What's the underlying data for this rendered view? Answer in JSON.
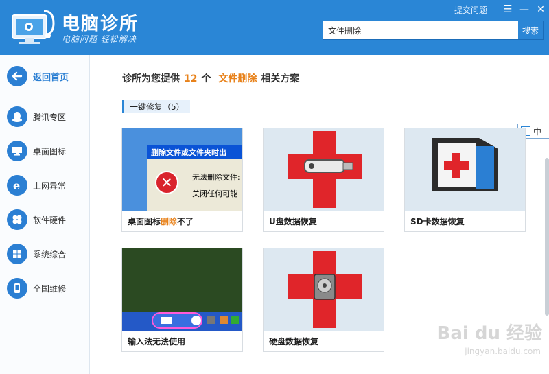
{
  "header": {
    "app_title": "电脑诊所",
    "slogan": "电脑问题 轻松解决",
    "submit_link": "提交问题",
    "menu_glyph": "☰",
    "min_glyph": "—",
    "close_glyph": "✕",
    "search_value": "文件删除",
    "search_button": "搜索"
  },
  "sidebar": {
    "items": [
      {
        "label": "返回首页",
        "icon": "back-arrow-icon"
      },
      {
        "label": "腾讯专区",
        "icon": "qq-penguin-icon"
      },
      {
        "label": "桌面图标",
        "icon": "monitor-icon"
      },
      {
        "label": "上网异常",
        "icon": "ie-browser-icon"
      },
      {
        "label": "软件硬件",
        "icon": "puzzle-icon"
      },
      {
        "label": "系统综合",
        "icon": "windows-icon"
      },
      {
        "label": "全国维修",
        "icon": "phone-icon"
      }
    ]
  },
  "main": {
    "summary_prefix": "诊所为您提供",
    "summary_count": "12",
    "summary_unit": "个",
    "summary_keyword": "文件删除",
    "summary_suffix": "相关方案",
    "section_label": "一键修复（5）",
    "side_float_label": "中",
    "cards": [
      {
        "title_pre": "桌面图标",
        "title_hl": "删除",
        "title_post": "不了",
        "dialog_title": "删除文件或文件夹时出",
        "dialog_line1": "无法删除文件:",
        "dialog_line2": "关闭任何可能"
      },
      {
        "title_pre": "U盘数据恢复",
        "title_hl": "",
        "title_post": ""
      },
      {
        "title_pre": "SD卡数据恢复",
        "title_hl": "",
        "title_post": ""
      },
      {
        "title_pre": "输入法无法使用",
        "title_hl": "",
        "title_post": ""
      },
      {
        "title_pre": "硬盘数据恢复",
        "title_hl": "",
        "title_post": ""
      }
    ]
  },
  "watermark": {
    "main": "Bai du 经验",
    "sub": "jingyan.baidu.com"
  },
  "colors": {
    "brand_blue": "#2a86d6",
    "accent_orange": "#e8821b",
    "red_cross": "#e0252a"
  }
}
